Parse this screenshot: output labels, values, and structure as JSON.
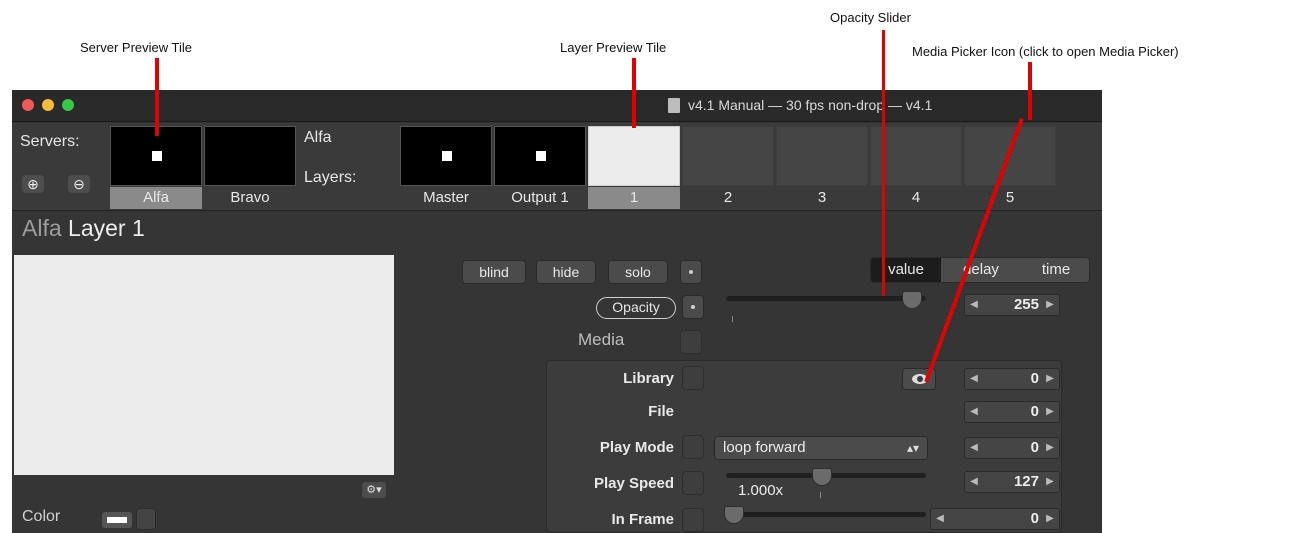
{
  "annotations": {
    "server_preview_tile": "Server Preview Tile",
    "layer_preview_tile": "Layer Preview Tile",
    "opacity_slider": "Opacity Slider",
    "media_picker_icon": "Media Picker Icon (click to open Media Picker)"
  },
  "window": {
    "title": "v4.1 Manual  —  30 fps non-drop  —  v4.1"
  },
  "strip": {
    "servers_label": "Servers:",
    "add_icon": "⊕",
    "remove_icon": "⊖",
    "servers": [
      {
        "label": "Alfa",
        "selected": true
      },
      {
        "label": "Bravo",
        "selected": false
      }
    ],
    "server_name": "Alfa",
    "layers_label": "Layers:",
    "layers": [
      {
        "label": "Master"
      },
      {
        "label": "Output 1"
      },
      {
        "label": "1"
      },
      {
        "label": "2"
      },
      {
        "label": "3"
      },
      {
        "label": "4"
      },
      {
        "label": "5"
      }
    ]
  },
  "panel": {
    "title_dim": "Alfa",
    "title_bright": "Layer 1",
    "color_label": "Color",
    "buttons": {
      "blind": "blind",
      "hide": "hide",
      "solo": "solo",
      "opacity": "Opacity"
    },
    "segments": {
      "value": "value",
      "delay": "delay",
      "time": "time"
    },
    "opacity_value": "255",
    "opacity_level": 255,
    "media_label": "Media",
    "rows": {
      "library": "Library",
      "file": "File",
      "play_mode": "Play Mode",
      "play_speed": "Play Speed",
      "in_frame": "In Frame"
    },
    "values": {
      "library": "0",
      "file": "0",
      "play_mode": "0",
      "play_speed": "127",
      "in_frame": "0"
    },
    "play_mode_option": "loop forward",
    "play_speed_display": "1.000x"
  }
}
